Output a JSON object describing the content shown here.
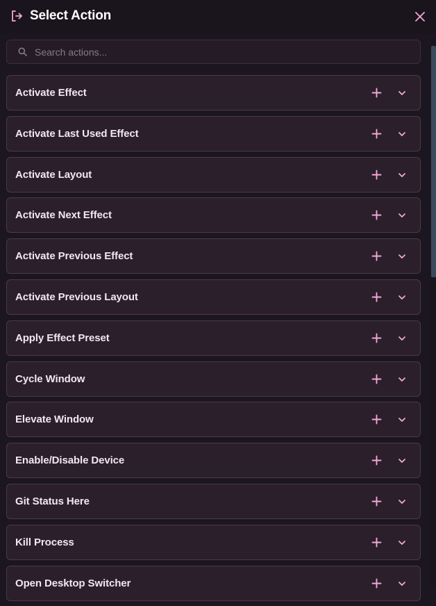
{
  "header": {
    "title": "Select Action",
    "icon": "exit-icon",
    "close_icon": "close-icon"
  },
  "search": {
    "placeholder": "Search actions...",
    "value": ""
  },
  "actions": [
    {
      "label": "Activate Effect"
    },
    {
      "label": "Activate Last Used Effect"
    },
    {
      "label": "Activate Layout"
    },
    {
      "label": "Activate Next Effect"
    },
    {
      "label": "Activate Previous Effect"
    },
    {
      "label": "Activate Previous Layout"
    },
    {
      "label": "Apply Effect Preset"
    },
    {
      "label": "Cycle Window"
    },
    {
      "label": "Elevate Window"
    },
    {
      "label": "Enable/Disable Device"
    },
    {
      "label": "Git Status Here"
    },
    {
      "label": "Kill Process"
    },
    {
      "label": "Open Desktop Switcher"
    }
  ],
  "colors": {
    "background": "#1c1620",
    "card": "#2b1f2c",
    "card_border": "#4a3a4a",
    "accent_pink": "#f3a8d6",
    "scrollbar": "#3a4a5c"
  }
}
